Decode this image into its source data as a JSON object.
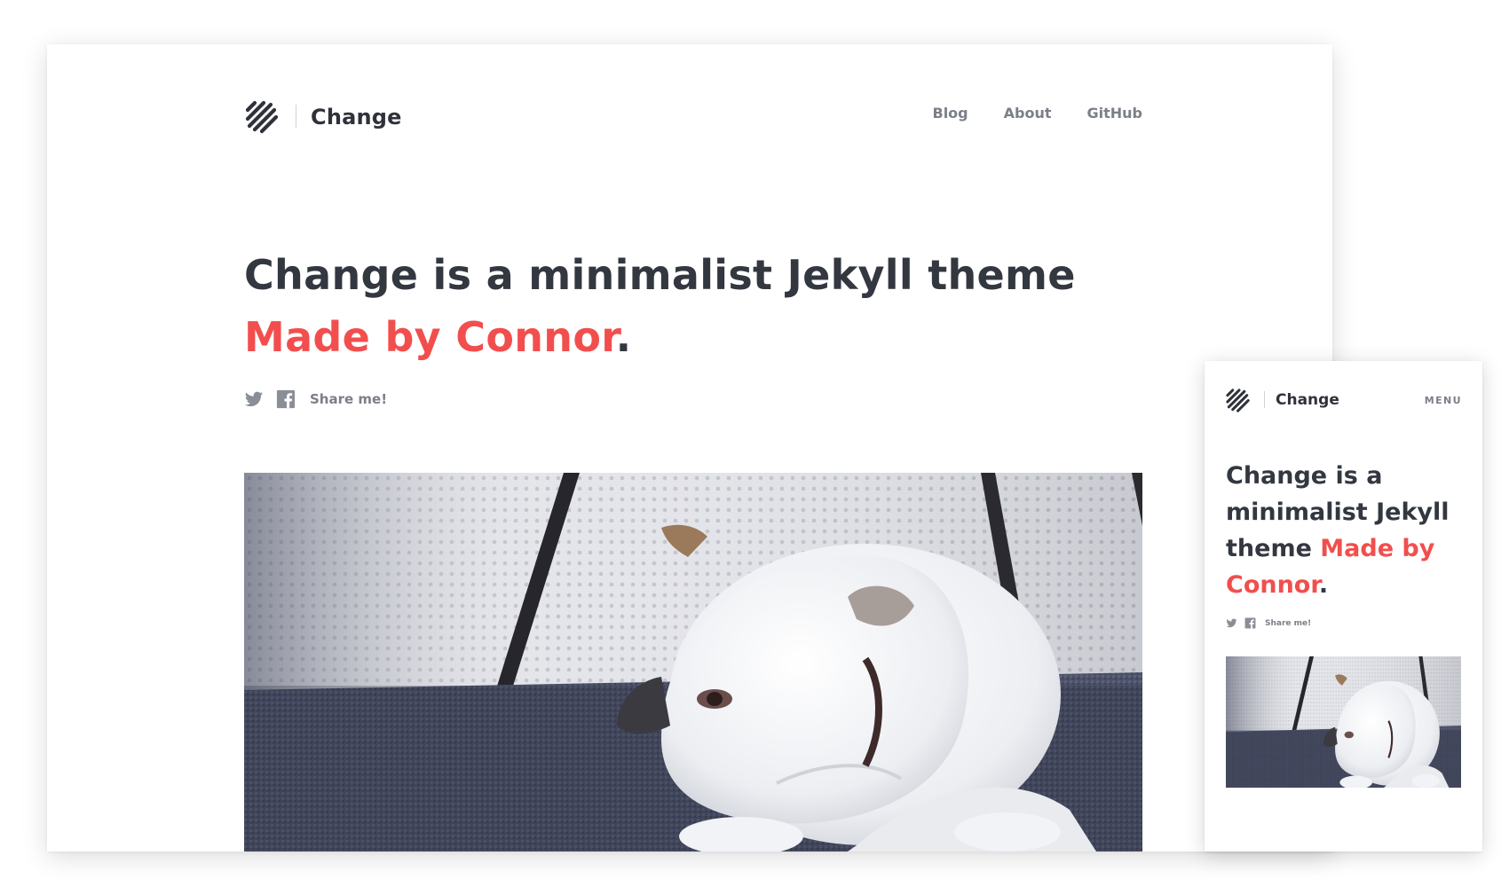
{
  "desktop": {
    "brand": {
      "name": "Change",
      "logo_icon": "diagonal-stripes-logo"
    },
    "nav": [
      {
        "label": "Blog"
      },
      {
        "label": "About"
      },
      {
        "label": "GitHub"
      }
    ],
    "hero": {
      "text_main": "Change is a minimalist Jekyll theme ",
      "text_accent": "Made by Connor",
      "text_end": "."
    },
    "share": {
      "label": "Share me!",
      "icons": [
        "twitter-icon",
        "facebook-icon"
      ]
    },
    "image": {
      "subject": "white-bulldog-photo"
    }
  },
  "mobile": {
    "brand": {
      "name": "Change"
    },
    "menu_label": "MENU",
    "hero": {
      "text_main": "Change is a minimalist Jekyll theme ",
      "text_accent": "Made by Connor",
      "text_end": "."
    },
    "share": {
      "label": "Share me!"
    }
  },
  "colors": {
    "accent": "#f24e4e",
    "text": "#333740",
    "muted": "#7b7f88"
  }
}
